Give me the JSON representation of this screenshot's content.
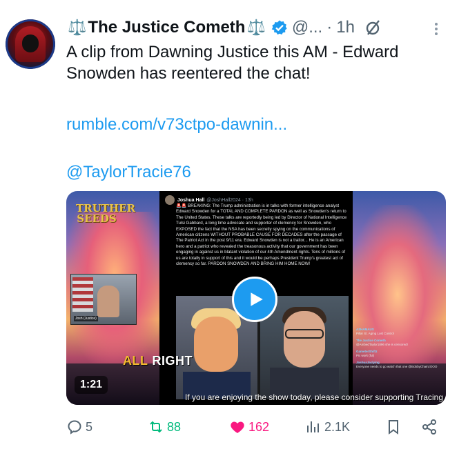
{
  "tweet": {
    "display_name": "The Justice Cometh",
    "name_emoji": "⚖️",
    "handle": "@...",
    "separator": "·",
    "time": "1h",
    "text": "A clip from Dawning Justice this AM - Edward Snowden has reentered the chat!",
    "link": "rumble.com/v73ctpo-dawnin...",
    "mention": "@TaylorTracie76"
  },
  "media": {
    "duration": "1:21",
    "brand": "TRUTHER SEEDS",
    "webcam_caption": "Josh (Justice)",
    "ticker": "If you are enjoying the show today, please consider supporting Tracing",
    "caption_word1": "ALL",
    "caption_word2": "RIGHT",
    "embedded_post": {
      "author": "Joshua Hall",
      "meta": "@JoshHall2024 · 13h",
      "text": "🚨🚨 BREAKING: The Trump administration is in talks with former intelligence analyst Edward Snowden for a TOTAL AND COMPLETE PARDON as well as Snowden's return to The United States. These talks are reportedly being led by Director of National Intelligence Tulsi Gabbard, a long time advocate and supporter of clemency for Snowden, who EXPOSED the fact that the NSA has been secretly spying on the communications of American citizens WITHOUT PROBABLE CAUSE FOR DECADES after the passage of The Patriot Act in the post 9/11 era. Edward Snowden is not a traitor... He is an American hero and a patriot who revealed the treasonous activity that our government has been engaging in against us in blatant violation of our 4th Amendment rights. Tens of millions of us are totally in support of this and it would be perhaps President Trump's greatest act of clemency so far. PARDON SNOWDEN AND BRING HIM HOME NOW!"
    },
    "chat": [
      {
        "user": "AZHAMAUS",
        "msg": "Pillar St. Aging Lost Control"
      },
      {
        "user": "The Justice Cometh",
        "msg": "@AmbedTaylor1896 she is censored!"
      },
      {
        "user": "GameterShiftz",
        "msg": "Pic work (ful)"
      },
      {
        "user": "JoshuaJaclying",
        "msg": "Everyone needs to go watch that one @BobbyChainzOOO"
      }
    ]
  },
  "actions": {
    "replies": "5",
    "reposts": "88",
    "likes": "162",
    "views": "2.1K"
  },
  "colors": {
    "accent": "#1d9bf0",
    "repost": "#00ba7c",
    "like": "#f91880",
    "muted": "#536471"
  },
  "icons": [
    "verified-badge-icon",
    "grok-icon",
    "more-icon",
    "play-icon",
    "reply-icon",
    "repost-icon",
    "like-icon",
    "views-icon",
    "bookmark-icon",
    "share-icon"
  ]
}
